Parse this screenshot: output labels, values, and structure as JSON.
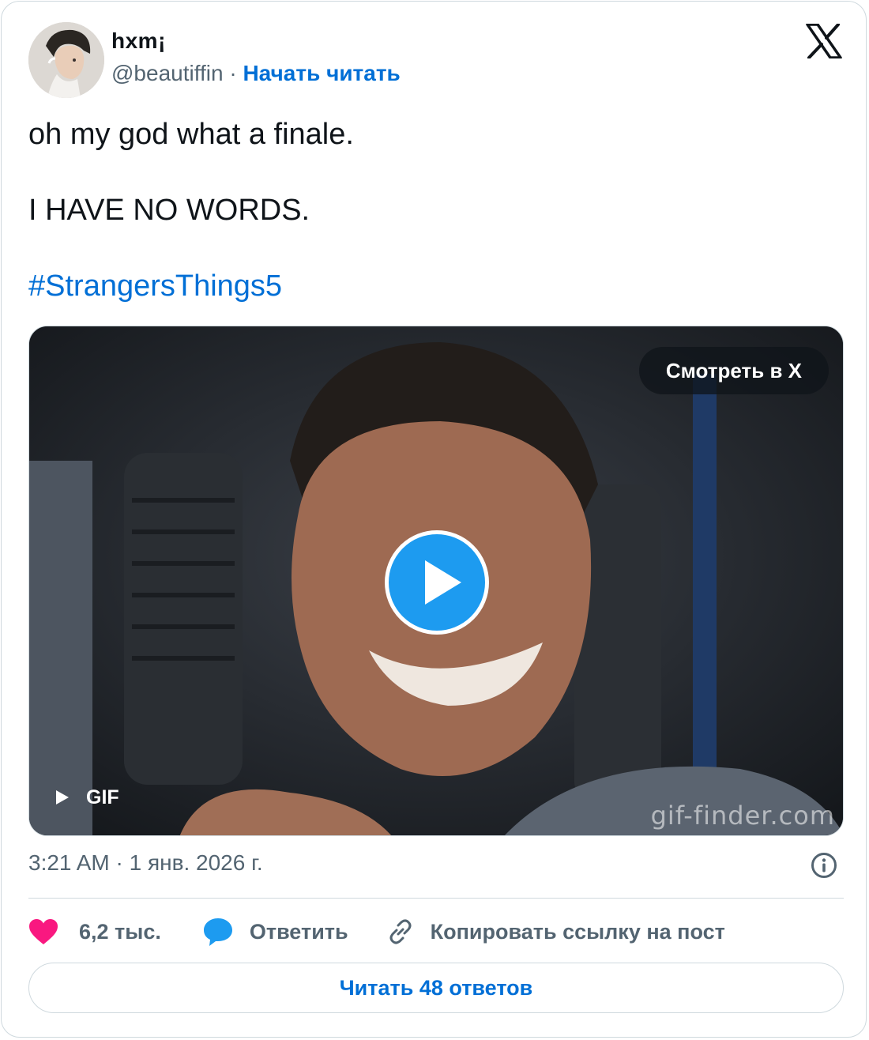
{
  "tweet": {
    "author_name": "hxm¡",
    "handle": "@beautiffin",
    "separator": "·",
    "follow_label": "Начать читать",
    "text_lines": [
      "oh my god what a finale.",
      "I HAVE NO WORDS."
    ],
    "hashtag": "#StrangersThings5",
    "timestamp": "3:21 AM · 1 янв. 2026 г."
  },
  "media": {
    "watch_label": "Смотреть в X",
    "gif_label": "GIF",
    "watermark": "gif-finder.com",
    "play_icon": "play-icon"
  },
  "actions": {
    "like_count": "6,2 тыс.",
    "reply_label": "Ответить",
    "copy_link_label": "Копировать ссылку на пост"
  },
  "footer": {
    "read_replies_label": "Читать 48 ответов"
  },
  "colors": {
    "link_blue": "#006fd6",
    "play_blue": "#1d9bf0",
    "like_pink": "#f91880",
    "muted_text": "#536471",
    "border": "#cfd9de"
  }
}
